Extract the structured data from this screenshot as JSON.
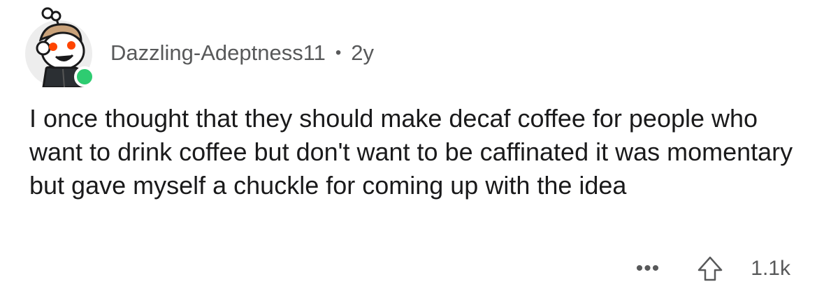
{
  "comment": {
    "author": "Dazzling-Adeptness11",
    "separator": "•",
    "age": "2y",
    "body": "I once thought that they should make decaf coffee for people who want to drink coffee but don't want to be caffinated it was momentary but gave myself a chuckle for coming up with the idea",
    "score": "1.1k",
    "more_label": "•••",
    "online": true
  },
  "icons": {
    "avatar": "snoo-avatar-icon",
    "status": "online-status-icon",
    "more": "more-options-icon",
    "upvote": "upvote-arrow-icon"
  },
  "colors": {
    "text_primary": "#1a1a1b",
    "text_secondary": "#58595a",
    "online": "#2ecc71"
  }
}
